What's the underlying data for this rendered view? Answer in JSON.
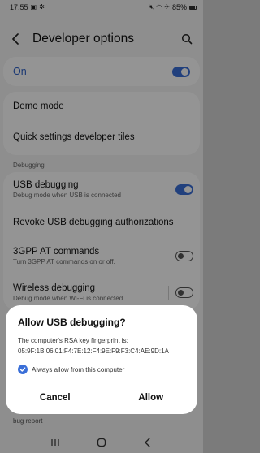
{
  "status_bar": {
    "time": "17:55",
    "battery": "85%",
    "left_icons": [
      "image-icon",
      "gear-icon"
    ],
    "right_icons": [
      "mute-icon",
      "wifi-icon",
      "airplane-icon",
      "battery-icon"
    ]
  },
  "header": {
    "title": "Developer options",
    "back_icon": "back-arrow-icon",
    "search_icon": "search-icon"
  },
  "master_toggle": {
    "label": "On",
    "enabled": true
  },
  "items": {
    "demo_mode": {
      "title": "Demo mode"
    },
    "qs_tiles": {
      "title": "Quick settings developer tiles"
    },
    "section_debugging": "Debugging",
    "usb_debugging": {
      "title": "USB debugging",
      "subtitle": "Debug mode when USB is connected",
      "enabled": true
    },
    "revoke": {
      "title": "Revoke USB debugging authorizations"
    },
    "gpp_at": {
      "title": "3GPP AT commands",
      "subtitle": "Turn 3GPP AT commands on or off.",
      "enabled": false
    },
    "wireless": {
      "title": "Wireless debugging",
      "subtitle": "Debug mode when Wi-Fi is connected",
      "enabled": false
    }
  },
  "dialog": {
    "title": "Allow USB debugging?",
    "body_line1": "The computer's RSA key fingerprint is:",
    "fingerprint": "05:9F:1B:06:01:F4:7E:12:F4:9E:F9:F3:C4:AE:9D:1A",
    "checkbox_label": "Always allow from this computer",
    "checkbox_checked": true,
    "cancel_label": "Cancel",
    "allow_label": "Allow"
  },
  "below_dialog_text": "bug report",
  "nav_bar": {
    "buttons": [
      "recents-icon",
      "home-icon",
      "back-icon"
    ]
  },
  "colors": {
    "accent": "#3a6fd8",
    "on_label": "#2b5fc7",
    "background": "#f5f5f5"
  }
}
